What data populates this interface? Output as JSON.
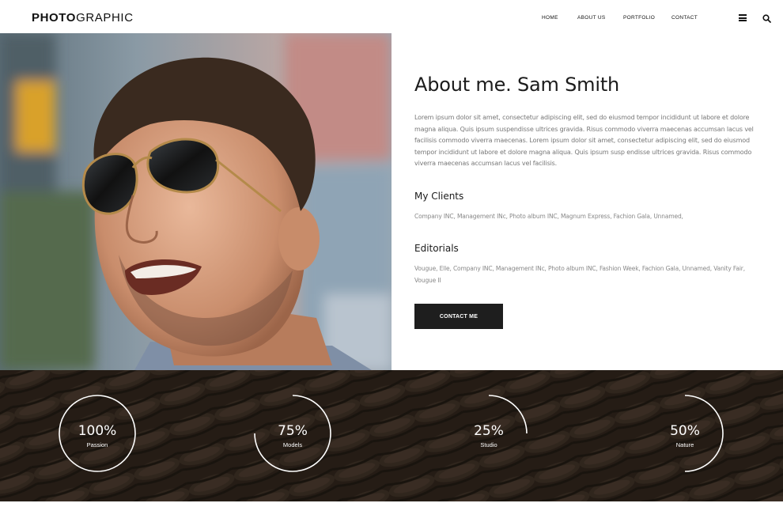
{
  "header": {
    "logo_bold": "PHOTO",
    "logo_thin": "GRAPHIC",
    "nav": [
      "HOME",
      "ABOUT US",
      "PORTFOLIO",
      "CONTACT"
    ],
    "icons": [
      "menu-icon",
      "search-icon"
    ]
  },
  "about": {
    "title": "About me. Sam Smith",
    "body": "Lorem ipsum dolor sit amet, consectetur adipiscing elit, sed do eiusmod tempor incididunt ut labore et dolore magna aliqua. Quis ipsum suspendisse ultrices gravida. Risus commodo viverra maecenas accumsan lacus vel facilisis commodo viverra maecenas. Lorem ipsum dolor sit amet, consectetur adipiscing elit, sed do eiusmod tempor incididunt ut labore et dolore magna aliqua. Quis ipsum susp endisse ultrices gravida. Risus commodo viverra maecenas accumsan lacus vel facilisis.",
    "clients_title": "My Clients",
    "clients_text": "Company INC, Management INc, Photo album INC, Magnum Express, Fachion Gala, Unnamed,",
    "editorials_title": "Editorials",
    "editorials_text": "Vougue, Elle, Company INC, Management INc, Photo album INC, Fashion Week, Fachion Gala, Unnamed, Vanity Fair, Vougue II",
    "contact_button": "CONTACT ME"
  },
  "stats": [
    {
      "value": "100%",
      "label": "Passion",
      "fraction": 1.0
    },
    {
      "value": "75%",
      "label": "Models",
      "fraction": 0.75
    },
    {
      "value": "25%",
      "label": "Studio",
      "fraction": 0.25
    },
    {
      "value": "50%",
      "label": "Nature",
      "fraction": 0.5
    }
  ],
  "colors": {
    "button_bg": "#1e1e1e",
    "stats_bg": "#2a211b",
    "ring": "#ffffff"
  }
}
